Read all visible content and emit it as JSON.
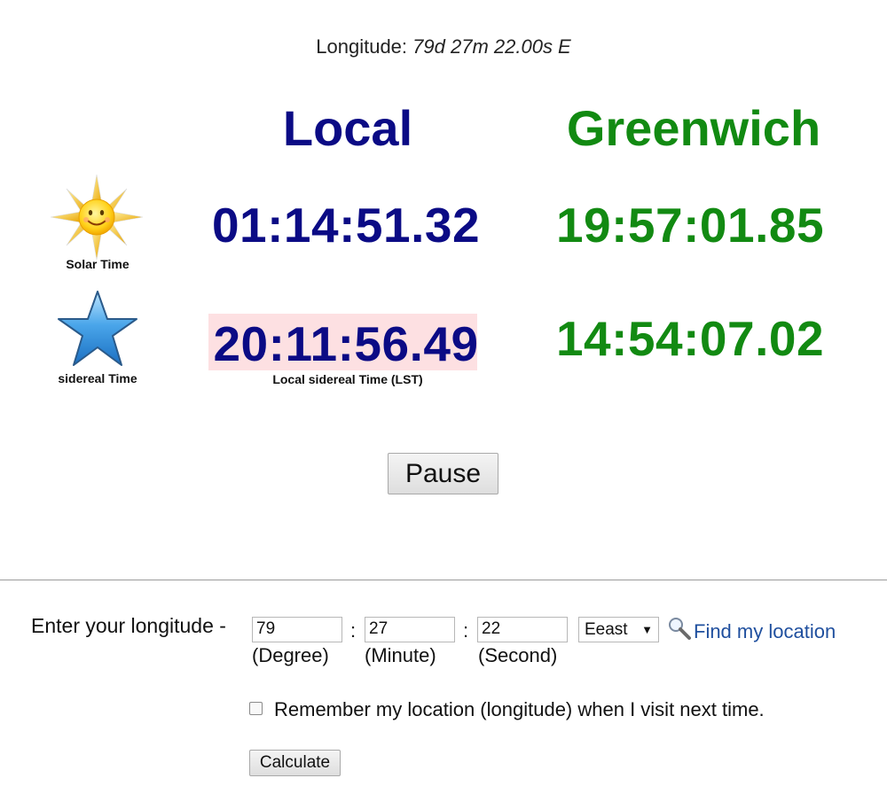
{
  "longitude_display": {
    "label": "Longitude:",
    "value": "79d 27m 22.00s E"
  },
  "columns": {
    "local": "Local",
    "greenwich": "Greenwich"
  },
  "solar": {
    "label": "Solar Time",
    "icon": "sun-icon",
    "local": "01:14:51.32",
    "greenwich": "19:57:01.85"
  },
  "sidereal": {
    "label": "sidereal Time",
    "icon": "star-icon",
    "local": "20:11:56.49",
    "local_label": "Local sidereal Time (LST)",
    "greenwich": "14:54:07.02"
  },
  "pause_label": "Pause",
  "form": {
    "prompt": "Enter your longitude -",
    "degree": {
      "value": "79",
      "unit": "(Degree)"
    },
    "minute": {
      "value": "27",
      "unit": "(Minute)"
    },
    "second": {
      "value": "22",
      "unit": "(Second)"
    },
    "separator": ":",
    "direction": "Eeast",
    "find_location": "Find my location",
    "remember_label": "Remember my location (longitude) when I visit next time.",
    "calculate_label": "Calculate"
  },
  "colors": {
    "local": "#0b0b85",
    "greenwich": "#128a12",
    "lst_highlight": "#fde0e2",
    "link": "#1f4f9e"
  }
}
